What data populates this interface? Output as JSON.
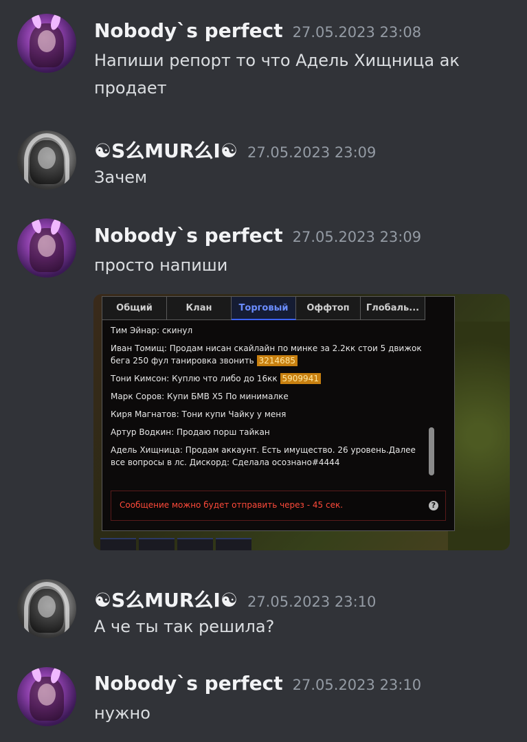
{
  "messages": [
    {
      "author": "Nobody`s perfect",
      "time": "27.05.2023 23:08",
      "text": "Напиши репорт то что Адель Хищница ак продает"
    },
    {
      "author": "☯S么MUR么I☯",
      "time": "27.05.2023 23:09",
      "text": "Зачем"
    },
    {
      "author": "Nobody`s perfect",
      "time": "27.05.2023 23:09",
      "text": "просто напиши"
    },
    {
      "author": "☯S么MUR么I☯",
      "time": "27.05.2023 23:10",
      "text": "А че ты так решила?"
    },
    {
      "author": "Nobody`s perfect",
      "time": "27.05.2023 23:10",
      "text": "нужно"
    }
  ],
  "attachment": {
    "tabs": [
      "Общий",
      "Клан",
      "Торговый",
      "Оффтоп",
      "Глобаль..."
    ],
    "active_tab": "Торговый",
    "lines": [
      {
        "text": "Тим Эйнар: скинул"
      },
      {
        "text": "Иван Томищ: Продам нисан скайлайн по минке за 2.2кк стои 5 движок бега 250 фул танировка звонить",
        "phone": "3214685"
      },
      {
        "text": "Тони Кимсон: Куплю что либо до 16кк",
        "phone": "5909941"
      },
      {
        "text": "Марк Соров: Купи БМВ X5 По минималке"
      },
      {
        "text": "Киря Магнатов: Тони купи Чайку у меня"
      },
      {
        "text": "Артур Водкин: Продаю порш тайкан"
      },
      {
        "text": "Адель Хищница: Продам аккаунт. Есть имущество. 26 уровень.Далее все вопросы в лс. Дискорд: Сделала осознано#4444"
      }
    ],
    "warning": "Сообщение можно будет отправить через -  45 сек.",
    "help": "?"
  }
}
